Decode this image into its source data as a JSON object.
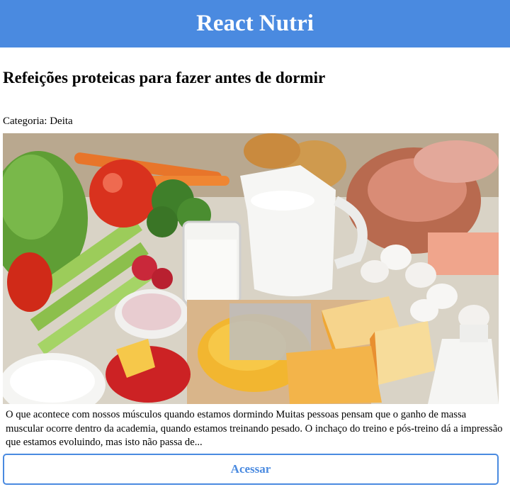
{
  "app": {
    "title": "React Nutri"
  },
  "post": {
    "title": "Refeições proteicas para fazer antes de dormir",
    "category_label": "Categoria: Deita",
    "image_alt": "foods-image",
    "excerpt": "O que acontece com nossos músculos quando estamos dormindo Muitas pessoas pensam que o ganho de massa muscular ocorre dentro da academia, quando estamos treinando pesado. O inchaço do treino e pós-treino dá a impressão que estamos evoluindo, mas isto não passa de...",
    "action_label": "Acessar"
  },
  "colors": {
    "brand": "#4a8ae0",
    "background": "#ffffff",
    "text": "#000000"
  }
}
